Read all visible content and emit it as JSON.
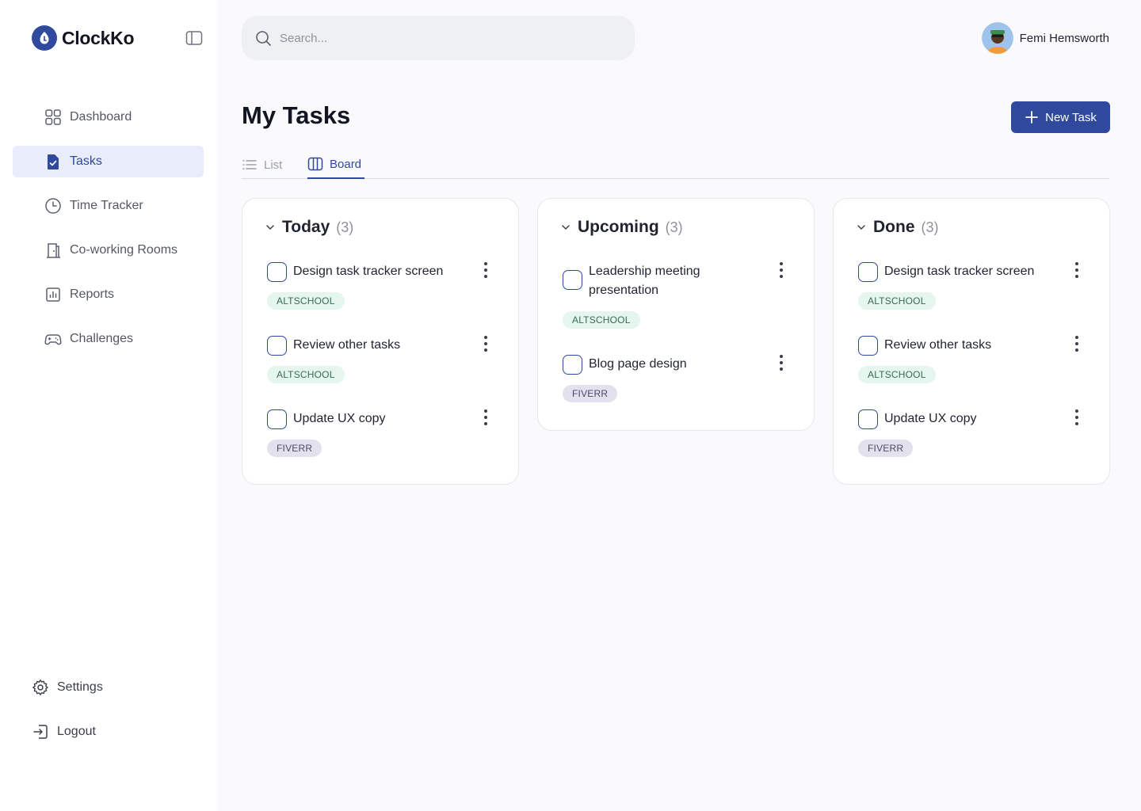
{
  "brand": {
    "name": "ClockKo"
  },
  "sidebar": {
    "items": [
      {
        "label": "Dashboard",
        "icon": "dashboard-icon"
      },
      {
        "label": "Tasks",
        "icon": "tasks-icon",
        "active": true
      },
      {
        "label": "Time Tracker",
        "icon": "clock-icon"
      },
      {
        "label": "Co-working Rooms",
        "icon": "door-icon"
      },
      {
        "label": "Reports",
        "icon": "reports-icon"
      },
      {
        "label": "Challenges",
        "icon": "gamepad-icon"
      }
    ],
    "bottom": [
      {
        "label": "Settings",
        "icon": "gear-icon"
      },
      {
        "label": "Logout",
        "icon": "logout-icon"
      }
    ]
  },
  "search": {
    "placeholder": "Search..."
  },
  "user": {
    "name": "Femi Hemsworth"
  },
  "header": {
    "title": "My Tasks",
    "new_task_label": "New Task"
  },
  "tabs": [
    {
      "label": "List",
      "icon": "list-icon",
      "active": false
    },
    {
      "label": "Board",
      "icon": "board-icon",
      "active": true
    }
  ],
  "columns": [
    {
      "title": "Today",
      "count": "(3)",
      "tasks": [
        {
          "title": "Design task tracker screen",
          "tag": "ALTSCHOOL"
        },
        {
          "title": "Review other tasks",
          "tag": "ALTSCHOOL"
        },
        {
          "title": "Update UX copy",
          "tag": "FIVERR"
        }
      ]
    },
    {
      "title": "Upcoming",
      "count": "(3)",
      "tasks": [
        {
          "title": "Leadership meeting presentation",
          "tag": "ALTSCHOOL"
        },
        {
          "title": "Blog page design",
          "tag": "FIVERR"
        }
      ]
    },
    {
      "title": "Done",
      "count": "(3)",
      "tasks": [
        {
          "title": "Design task tracker screen",
          "tag": "ALTSCHOOL"
        },
        {
          "title": "Review other tasks",
          "tag": "ALTSCHOOL"
        },
        {
          "title": "Update UX copy",
          "tag": "FIVERR"
        }
      ]
    }
  ],
  "colors": {
    "primary": "#2f4a9c",
    "tag_green_bg": "#e4f6ee",
    "tag_purple_bg": "#e4e1ef"
  }
}
